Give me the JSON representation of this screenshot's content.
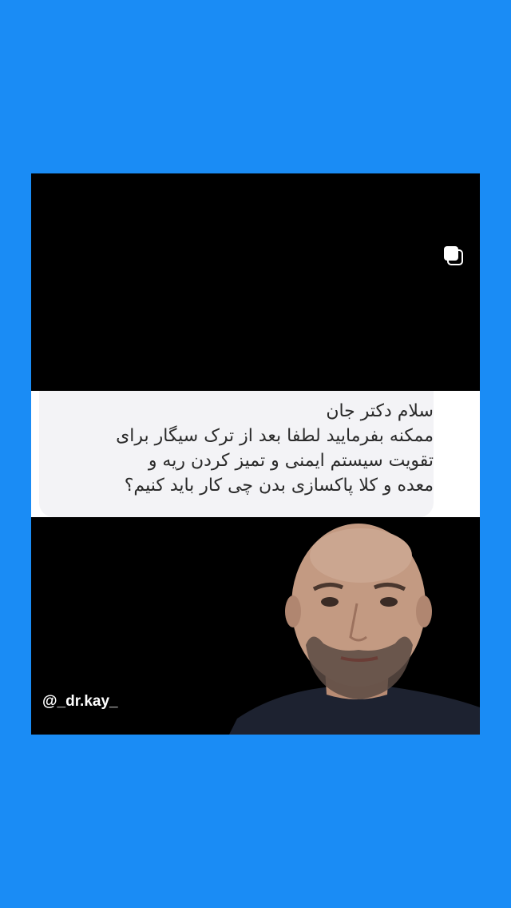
{
  "post": {
    "multiple_media_icon": "stacked-squares-icon",
    "question_lines": [
      "سلام دکتر جان",
      "ممکنه بفرمایید لطفا بعد از ترک سیگار برای",
      "تقویت سیستم ایمنی و تمیز کردن ریه و",
      "معده و کلا پاکسازی بدن چی کار باید کنیم؟"
    ],
    "handle": "@_dr.kay_"
  },
  "colors": {
    "background": "#1a8cf5",
    "video": "#000000",
    "question_card": "#ffffff"
  }
}
